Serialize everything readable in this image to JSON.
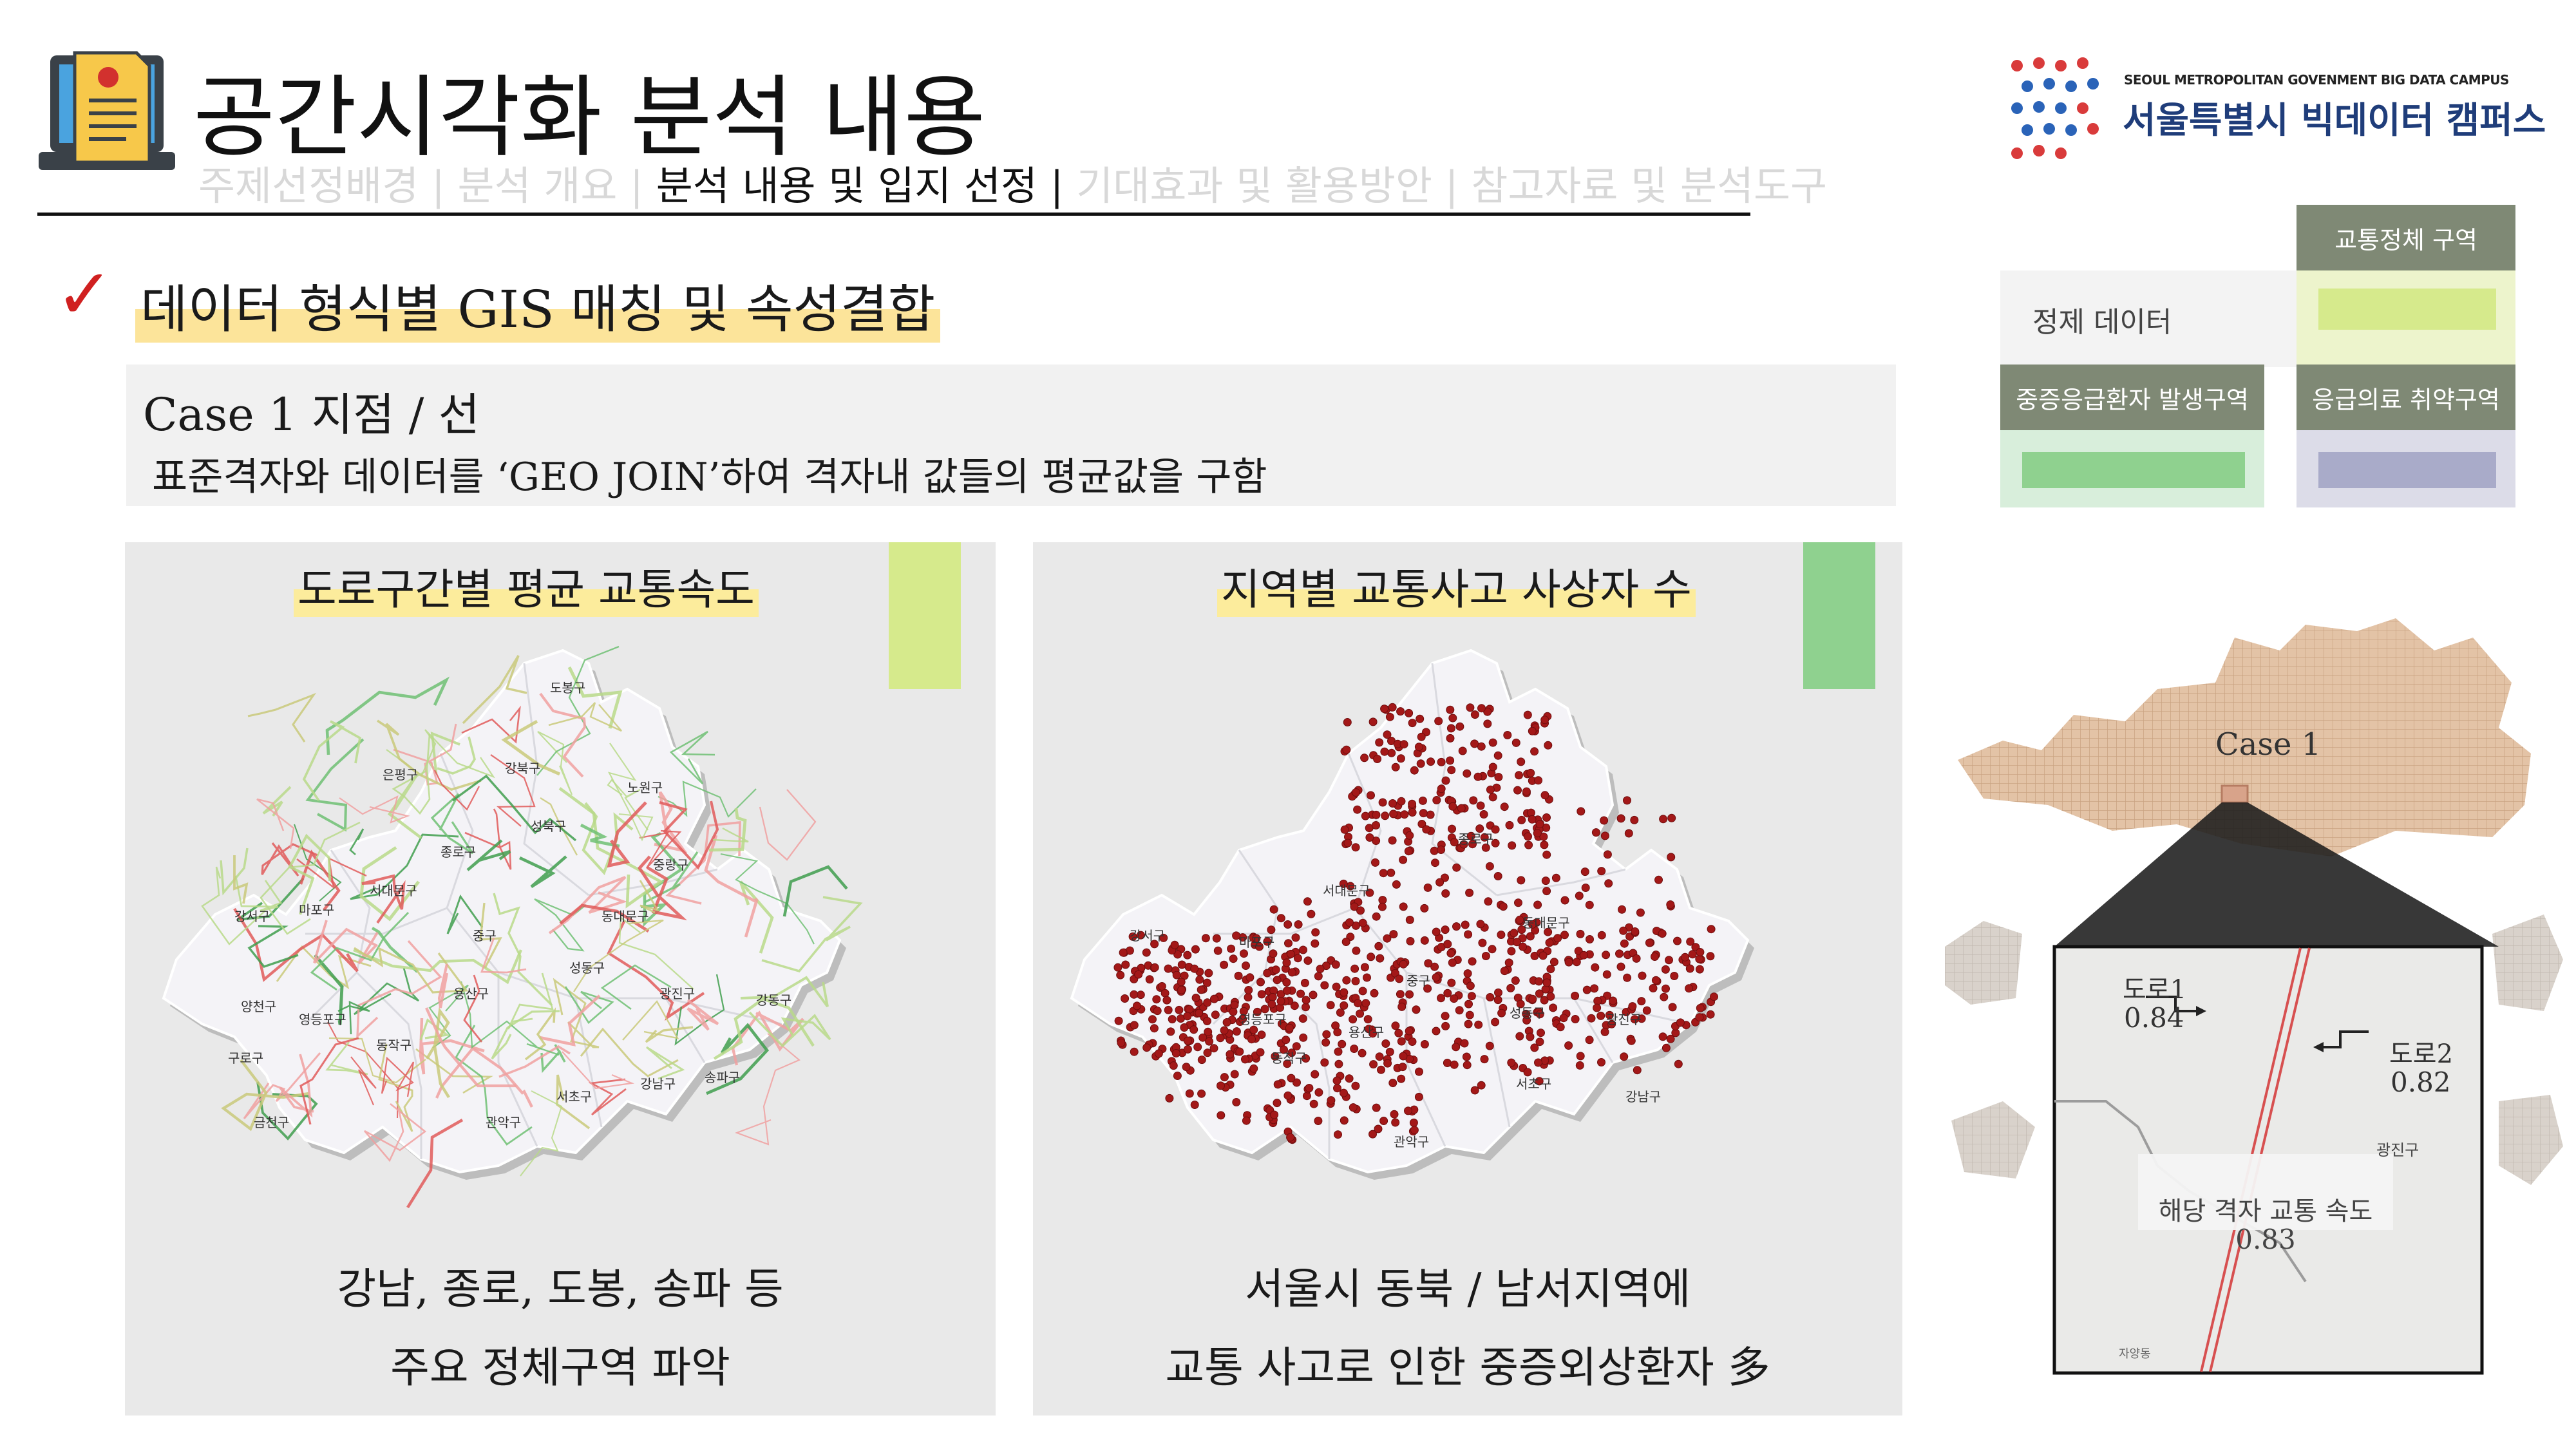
{
  "header": {
    "title": "공간시각화 분석 내용",
    "nav": [
      {
        "label": "주제선정배경 | 분석 개요 | ",
        "active": false
      },
      {
        "label": "분석 내용 및 입지 선정",
        "active": true
      },
      {
        "label": " | ",
        "active": true
      },
      {
        "label": "기대효과 및 활용방안 | 참고자료 및 분석도구",
        "active": false
      }
    ],
    "logo": {
      "english": "SEOUL METROPOLITAN GOVENMENT BIG DATA CAMPUS",
      "korean": "서울특별시 빅데이터 캠퍼스"
    }
  },
  "section": {
    "check": "✓",
    "title": "데이터 형식별 GIS 매칭 및 속성결합"
  },
  "case": {
    "title": "Case 1 지점 / 선",
    "description": "표준격자와 데이터를 ‘GEO JOIN’하여 격자내 값들의 평균값을 구함"
  },
  "legend": {
    "row_label": "정제 데이터",
    "traffic_congestion": "교통정체 구역",
    "severe_emergency": "중증응급환자 발생구역",
    "emergency_vulnerable": "응급의료 취약구역",
    "colors": {
      "header_dark": "#7f8975",
      "yellow_green": "#d6ea8c",
      "green": "#8fd18f",
      "grey_blue": "#a9abc9"
    }
  },
  "panels": [
    {
      "title": "도로구간별 평균 교통속도",
      "swatch_color": "#d6ea8c",
      "caption_line1": "강남, 종로, 도봉, 송파 등",
      "caption_line2": "주요  정체구역 파악",
      "districts": [
        "도봉구",
        "강북구",
        "노원구",
        "은평구",
        "성북구",
        "종로구",
        "서대문구",
        "중랑구",
        "마포구",
        "동대문구",
        "중구",
        "강서구",
        "용산구",
        "성동구",
        "광진구",
        "양천구",
        "영등포구",
        "동작구",
        "강동구",
        "구로구",
        "송파구",
        "강남구",
        "서초구",
        "금천구",
        "관악구"
      ]
    },
    {
      "title": "지역별 교통사고 사상자 수",
      "swatch_color": "#8fd18f",
      "caption_line1": "서울시 동북 / 남서지역에",
      "caption_line2": "교통 사고로 인한 중증외상환자 多",
      "districts": [
        "종로구",
        "서대문구",
        "강서구",
        "마포구",
        "중구",
        "영등포구",
        "동대문구",
        "성동구",
        "광진구",
        "동작구",
        "용산구",
        "서초구",
        "관악구",
        "강남구"
      ]
    }
  ],
  "inset": {
    "case_label": "Case 1",
    "road1_label": "도로1",
    "road1_value": "0.84",
    "road2_label": "도로2",
    "road2_value": "0.82",
    "district": "광진구",
    "result_label": "해당 격자 교통 속도",
    "result_value": "0.83",
    "street": "자양동"
  }
}
